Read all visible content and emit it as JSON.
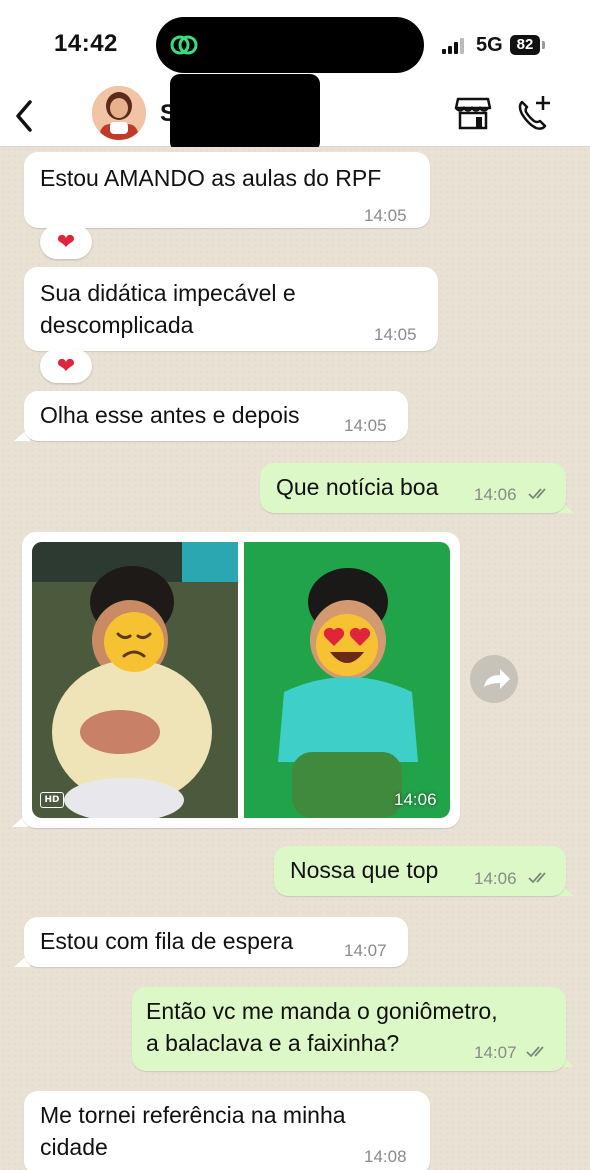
{
  "status_bar": {
    "time": "14:42",
    "network": "5G",
    "battery": "82"
  },
  "header": {
    "contact_name": "S            y Almei..."
  },
  "messages": [
    {
      "lines": [
        "Estou AMANDO as aulas do RPF"
      ],
      "time": "14:05"
    },
    {
      "lines": [
        "Sua didática impecável e",
        "descomplicada"
      ],
      "time": "14:05"
    },
    {
      "lines": [
        "Olha esse antes e depois"
      ],
      "time": "14:05"
    },
    {
      "lines": [
        "Que notícia boa"
      ],
      "time": "14:06"
    },
    {
      "photo_time": "14:06"
    },
    {
      "lines": [
        "Nossa que top"
      ],
      "time": "14:06"
    },
    {
      "lines": [
        "Estou com fila de espera"
      ],
      "time": "14:07"
    },
    {
      "lines": [
        "Então vc me manda o goniômetro,",
        "a balaclava e a faixinha?"
      ],
      "time": "14:07"
    },
    {
      "lines": [
        "Me tornei referência na minha",
        "cidade"
      ],
      "time": "14:08"
    }
  ],
  "reaction_emoji": "❤",
  "photo_badge": "HD",
  "icons": [
    "back-icon",
    "store-icon",
    "call-add-icon",
    "forward-icon",
    "double-check-icon",
    "heart-icon",
    "sad-face-emoji",
    "heart-eyes-emoji"
  ],
  "colors": {
    "incoming": "#ffffff",
    "outgoing": "#dcf8c6",
    "wallpaper": "#e9e1d4",
    "check": "#7a8a7a"
  }
}
